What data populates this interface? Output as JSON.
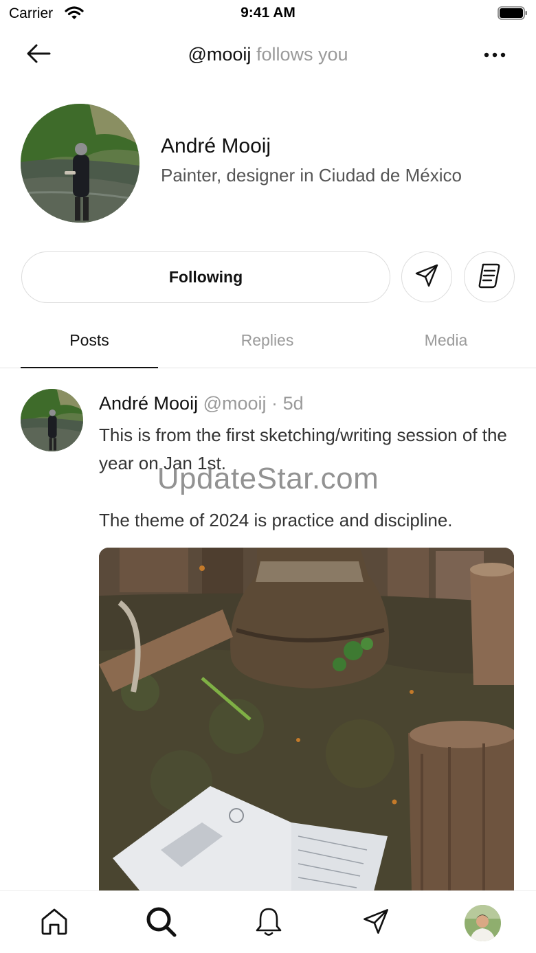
{
  "status_bar": {
    "carrier": "Carrier",
    "time": "9:41 AM",
    "icons": [
      "wifi-icon",
      "battery-icon"
    ]
  },
  "header": {
    "handle": "@mooij",
    "relation": "follows you",
    "icons": [
      "back-arrow-icon",
      "more-icon"
    ]
  },
  "profile": {
    "name": "André Mooij",
    "bio": "Painter, designer in Ciudad de México"
  },
  "actions": {
    "following_label": "Following",
    "icons": [
      "send-icon",
      "notes-icon"
    ]
  },
  "tabs": {
    "items": [
      "Posts",
      "Replies",
      "Media"
    ],
    "active": "Posts"
  },
  "post": {
    "author": "André Mooij",
    "handle": "@mooij",
    "separator": "·",
    "age": "5d",
    "paragraphs": [
      "This is from the first sketching/writing session of the year on Jan 1st.",
      "The theme of 2024 is practice and discipline."
    ]
  },
  "watermark": "UpdateStar.com",
  "bottom_nav": {
    "icons": [
      "home-icon",
      "search-icon",
      "bell-icon",
      "send-icon",
      "profile-avatar"
    ]
  },
  "colors": {
    "text": "#111111",
    "muted": "#9a9a9a",
    "border": "#dcdcdc"
  }
}
